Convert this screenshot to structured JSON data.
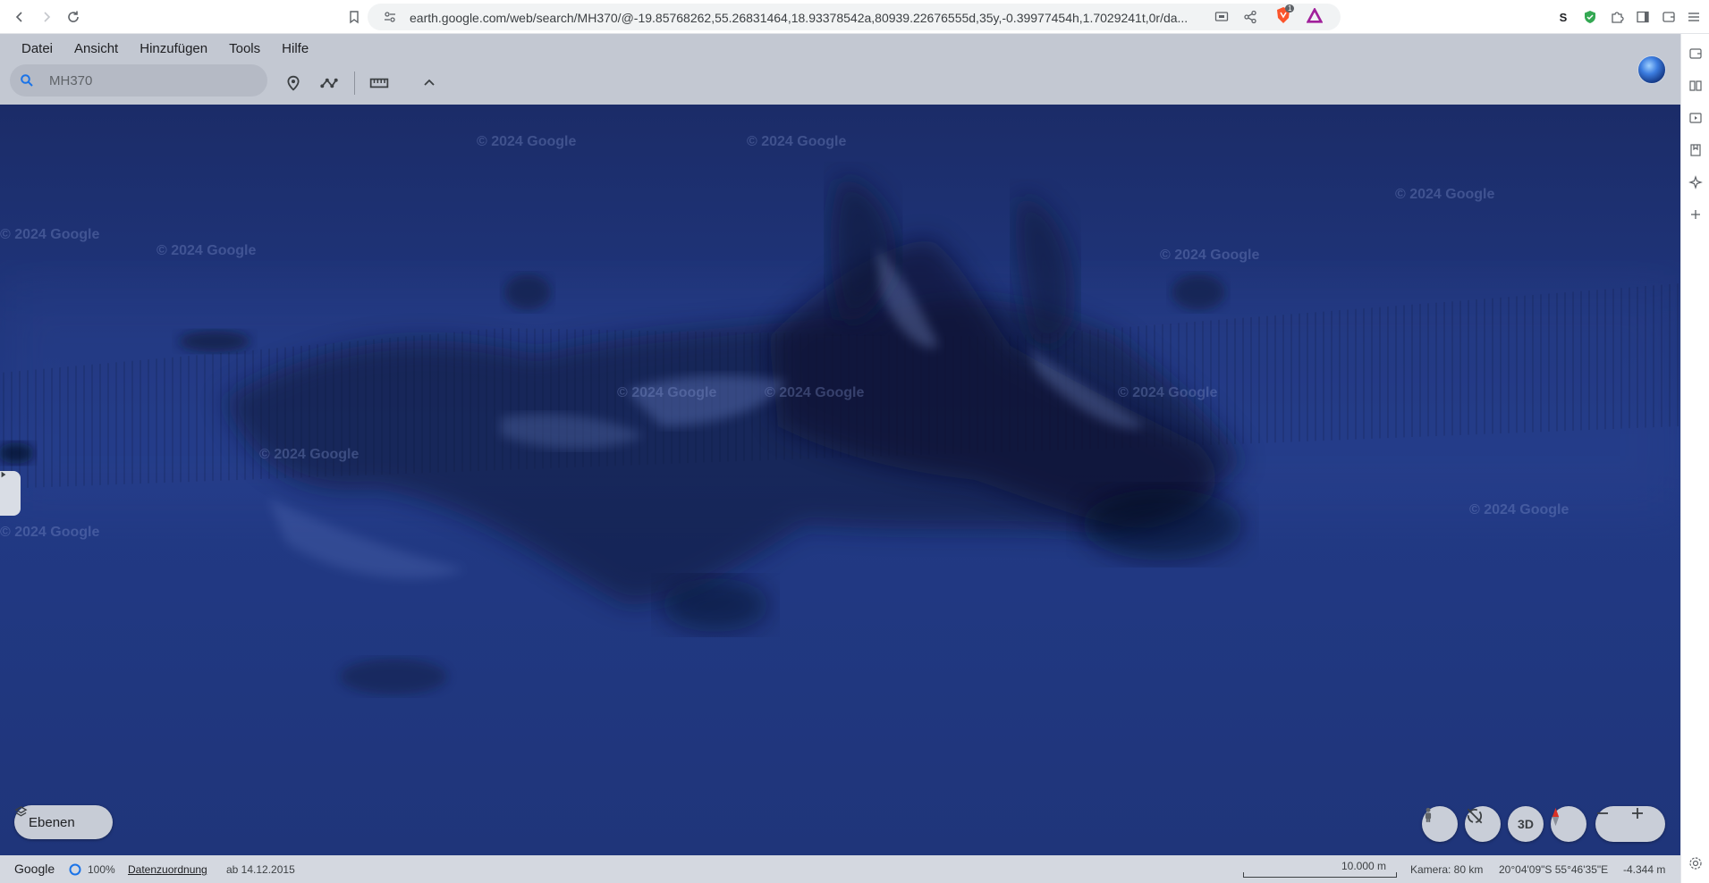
{
  "browser": {
    "url": "earth.google.com/web/search/MH370/@-19.85768262,55.26831464,18.93378542a,80939.22676555d,35y,-0.39977454h,1.7029241t,0r/da...",
    "extension_badge": "1"
  },
  "menu": {
    "items": [
      "Datei",
      "Ansicht",
      "Hinzufügen",
      "Tools",
      "Hilfe"
    ]
  },
  "search": {
    "value": "MH370"
  },
  "map": {
    "watermark": "© 2024 Google"
  },
  "controls": {
    "layers_label": "Ebenen",
    "three_d_label": "3D"
  },
  "status": {
    "brand": "Google",
    "load_percent": "100%",
    "attribution_link": "Datenzuordnung",
    "imagery_date": "ab 14.12.2015",
    "scale_label": "10.000 m",
    "camera": "Kamera: 80 km",
    "coordinates": "20°04'09\"S 55°46'35\"E",
    "elevation": "-4.344 m"
  },
  "colors": {
    "ocean": "#223a86",
    "accent": "#1a73e8"
  }
}
